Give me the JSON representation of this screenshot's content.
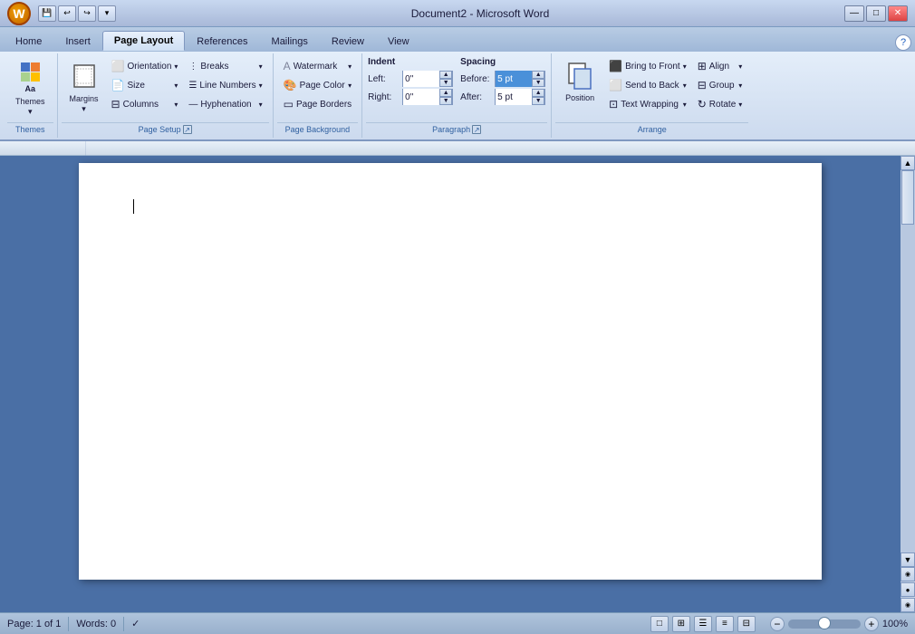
{
  "titleBar": {
    "title": "Document2 - Microsoft Word",
    "minimize": "—",
    "maximize": "□",
    "close": "✕"
  },
  "quickAccess": [
    "💾",
    "↩",
    "↪"
  ],
  "tabs": [
    {
      "label": "Home",
      "active": false
    },
    {
      "label": "Insert",
      "active": false
    },
    {
      "label": "Page Layout",
      "active": true
    },
    {
      "label": "References",
      "active": false
    },
    {
      "label": "Mailings",
      "active": false
    },
    {
      "label": "Review",
      "active": false
    },
    {
      "label": "View",
      "active": false
    }
  ],
  "ribbon": {
    "groups": {
      "themes": {
        "label": "Themes",
        "buttons": [
          "Themes"
        ]
      },
      "pageSetup": {
        "label": "Page Setup",
        "buttons": [
          {
            "label": "Margins",
            "icon": "📄"
          },
          {
            "label": "Orientation",
            "icon": ""
          },
          {
            "label": "Size",
            "icon": ""
          },
          {
            "label": "Columns",
            "icon": ""
          },
          {
            "label": "Breaks",
            "icon": ""
          },
          {
            "label": "Line Numbers",
            "icon": ""
          },
          {
            "label": "Hyphenation",
            "icon": ""
          }
        ]
      },
      "pageBackground": {
        "label": "Page Background",
        "buttons": [
          {
            "label": "Watermark",
            "icon": ""
          },
          {
            "label": "Page Color",
            "icon": ""
          },
          {
            "label": "Page Borders",
            "icon": ""
          }
        ]
      },
      "paragraph": {
        "label": "Paragraph",
        "indent": {
          "label": "Indent",
          "left": {
            "label": "Left:",
            "value": "0\""
          },
          "right": {
            "label": "Right:",
            "value": "0\""
          }
        },
        "spacing": {
          "label": "Spacing",
          "before": {
            "label": "Before:",
            "value": "5 pt"
          },
          "after": {
            "label": "After:",
            "value": "5 pt"
          }
        }
      },
      "arrange": {
        "label": "Arrange",
        "position": "Position",
        "buttons": [
          {
            "label": "Bring to Front",
            "icon": ""
          },
          {
            "label": "Send to Back",
            "icon": ""
          },
          {
            "label": "Text Wrapping",
            "icon": ""
          },
          {
            "label": "Align",
            "icon": ""
          },
          {
            "label": "Group",
            "icon": ""
          },
          {
            "label": "Rotate",
            "icon": ""
          }
        ]
      }
    }
  },
  "statusBar": {
    "page": "Page: 1 of 1",
    "words": "Words: 0",
    "zoom": "100%"
  },
  "viewButtons": [
    "□",
    "☰",
    "⊞",
    "⊟",
    "≡"
  ]
}
